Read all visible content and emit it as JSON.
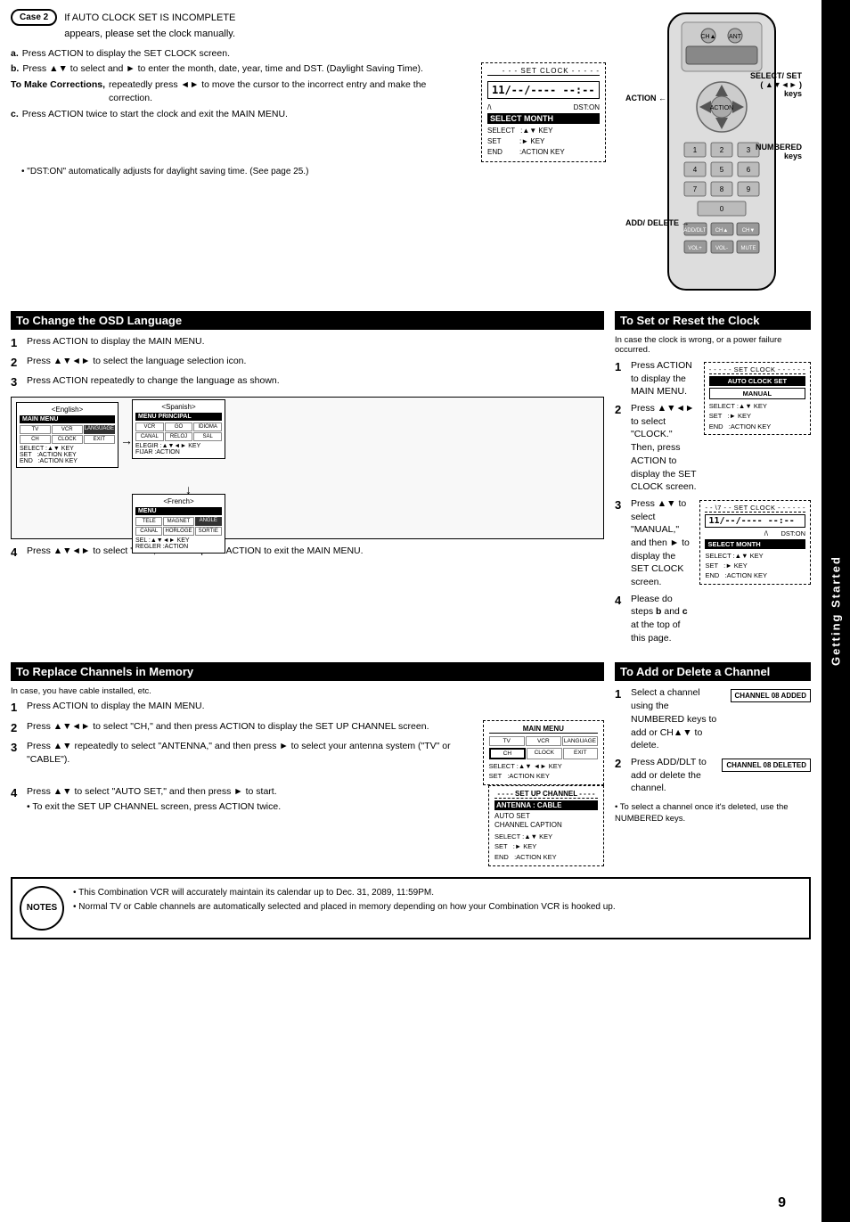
{
  "page": {
    "number": "9",
    "side_tab": "Getting Started"
  },
  "case2": {
    "badge": "Case 2",
    "title_line1": "If AUTO CLOCK SET IS INCOMPLETE",
    "title_line2": "appears, please set the clock manually.",
    "steps": [
      {
        "label": "a.",
        "text": "Press ACTION to display the SET CLOCK screen."
      },
      {
        "label": "b.",
        "text": "Press ▲▼ to select and ► to enter the month, date, year, time and DST. (Daylight Saving Time)."
      },
      {
        "label": "To Make Corrections,",
        "text": "repeatedly press ◄► to move the cursor to the incorrect entry and make the correction."
      },
      {
        "label": "c.",
        "text": "Press ACTION twice to start the clock and exit the MAIN MENU."
      }
    ],
    "set_clock_box": {
      "title": "SET CLOCK",
      "display": "11/--/---- --:--",
      "dst": "DST:ON",
      "select_month": "SELECT MONTH",
      "keys": [
        {
          "label": "SELECT",
          "key": ":▲▼ KEY"
        },
        {
          "label": "SET",
          "key": ":► KEY"
        },
        {
          "label": "END",
          "key": ":ACTION KEY"
        }
      ]
    },
    "dst_note": "\"DST:ON\" automatically adjusts for daylight saving time. (See page 25.)"
  },
  "osd_section": {
    "header": "To Change the OSD Language",
    "steps": [
      {
        "num": "1",
        "text": "Press ACTION to display the MAIN MENU."
      },
      {
        "num": "2",
        "text": "Press ▲▼◄► to select the language selection icon."
      },
      {
        "num": "3",
        "text": "Press ACTION repeatedly to change the language as shown."
      },
      {
        "num": "4",
        "text": "Press ▲▼◄►  to select \"EXIT,\" and then press ACTION to exit the MAIN MENU."
      }
    ],
    "languages": [
      {
        "label": "<English>",
        "menu_title": "MAIN MENU"
      },
      {
        "label": "<Spanish>",
        "menu_title": "MENU PRINCIPAL"
      },
      {
        "label": "<French>",
        "menu_title": "MENU"
      }
    ]
  },
  "replace_channels": {
    "header": "To Replace Channels in Memory",
    "subtitle": "In case, you have cable installed, etc.",
    "steps": [
      {
        "num": "1",
        "text": "Press ACTION to display the MAIN MENU."
      },
      {
        "num": "2",
        "text": "Press ▲▼◄►  to select \"CH,\" and then press ACTION to display the SET UP CHANNEL screen."
      },
      {
        "num": "3",
        "text": "Press ▲▼ repeatedly to select \"ANTENNA,\" and then press ► to select your antenna system (\"TV\" or \"CABLE\")."
      },
      {
        "num": "4",
        "text": "Press ▲▼ to select \"AUTO SET,\" and then press ► to start."
      }
    ],
    "exit_note": "• To exit the SET UP CHANNEL screen, press ACTION twice.",
    "main_menu_box": {
      "title": "MAIN MENU",
      "cells": [
        "TV",
        "VCR",
        "LANGUAGE",
        "CH",
        "CLOCK",
        "EXIT"
      ],
      "keys": [
        {
          "label": "SELECT",
          "key": ":▲▼ ◄► KEY"
        },
        {
          "label": "SET",
          "key": ":ACTION KEY"
        }
      ]
    },
    "setup_channel_box": {
      "title": "SET UP CHANNEL",
      "antenna_label": "ANTENNA : CABLE",
      "items": [
        "AUTO SET",
        "CHANNEL CAPTION"
      ],
      "keys": [
        {
          "label": "SELECT",
          "key": ":▲▼ KEY"
        },
        {
          "label": "SET",
          "key": ":► KEY"
        },
        {
          "label": "END",
          "key": ":ACTION KEY"
        }
      ]
    }
  },
  "set_reset_clock": {
    "header": "To Set or Reset the Clock",
    "subtitle": "In case the clock is wrong, or a power failure occurred.",
    "steps": [
      {
        "num": "1",
        "text": "Press ACTION to display the MAIN MENU."
      },
      {
        "num": "2",
        "text": "Press ▲▼◄► to select \"CLOCK.\" Then, press ACTION to display the SET CLOCK screen."
      },
      {
        "num": "3",
        "text": "Press ▲▼ to select \"MANUAL,\" and then ► to display the SET CLOCK screen."
      },
      {
        "num": "4",
        "text": "Please do steps b and c at the top of this page."
      }
    ],
    "clock_box1": {
      "title": "SET CLOCK",
      "auto_clock": "AUTO CLOCK SET",
      "manual": "MANUAL",
      "keys": [
        {
          "label": "SELECT",
          "key": ":▲▼ KEY"
        },
        {
          "label": "SET",
          "key": ":► KEY"
        },
        {
          "label": "END",
          "key": ":ACTION KEY"
        }
      ]
    },
    "clock_box2": {
      "title": "SET CLOCK",
      "display": "11/--/---- --:--",
      "dst": "DST:ON",
      "select_month": "SELECT MONTH",
      "keys": [
        {
          "label": "SELECT",
          "key": ":▲▼ KEY"
        },
        {
          "label": "SET",
          "key": ":► KEY"
        },
        {
          "label": "END",
          "key": ":ACTION KEY"
        }
      ]
    }
  },
  "add_delete_channel": {
    "header": "To Add or Delete a Channel",
    "steps": [
      {
        "num": "1",
        "text": "Select a channel using the NUMBERED keys to add or CH▲▼ to delete."
      },
      {
        "num": "2",
        "text": "Press ADD/DLT to add or delete the channel."
      }
    ],
    "channel_added": "CHANNEL 08 ADDED",
    "channel_deleted": "CHANNEL 08 DELETED",
    "note": "• To select a channel once it's deleted, use the NUMBERED keys."
  },
  "remote": {
    "action_label": "ACTION",
    "select_set_label": "SELECT/ SET",
    "select_set_sub": "( ▲▼◄► )",
    "keys_label": "keys",
    "numbered_label": "NUMBERED",
    "numbered_keys": "keys",
    "add_delete_label": "ADD/ DELETE"
  },
  "notes": {
    "badge": "NOTES",
    "items": [
      "This Combination VCR will accurately maintain its calendar up to Dec. 31, 2089, 11:59PM.",
      "Normal TV or Cable channels are automatically selected and placed in memory depending on how your Combination VCR is hooked up."
    ]
  }
}
